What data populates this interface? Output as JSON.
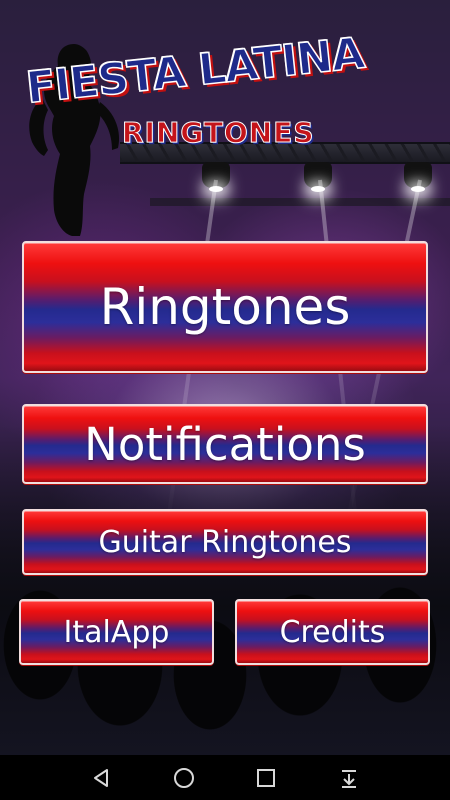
{
  "logo": {
    "title": "FIESTA LATINA",
    "subtitle": "RINGTONES"
  },
  "menu": {
    "ringtones_label": "Ringtones",
    "notifications_label": "Notifications",
    "guitar_label": "Guitar Ringtones",
    "italapp_label": "ItalApp",
    "credits_label": "Credits"
  },
  "colors": {
    "button_red": "#e0141a",
    "button_blue": "#242a8e",
    "logo_blue": "#1e2a8a",
    "logo_red": "#c4141a",
    "navbar": "#000000"
  },
  "navbar": {
    "icons": [
      "back-icon",
      "home-icon",
      "recents-icon",
      "notification-pull-icon"
    ]
  }
}
